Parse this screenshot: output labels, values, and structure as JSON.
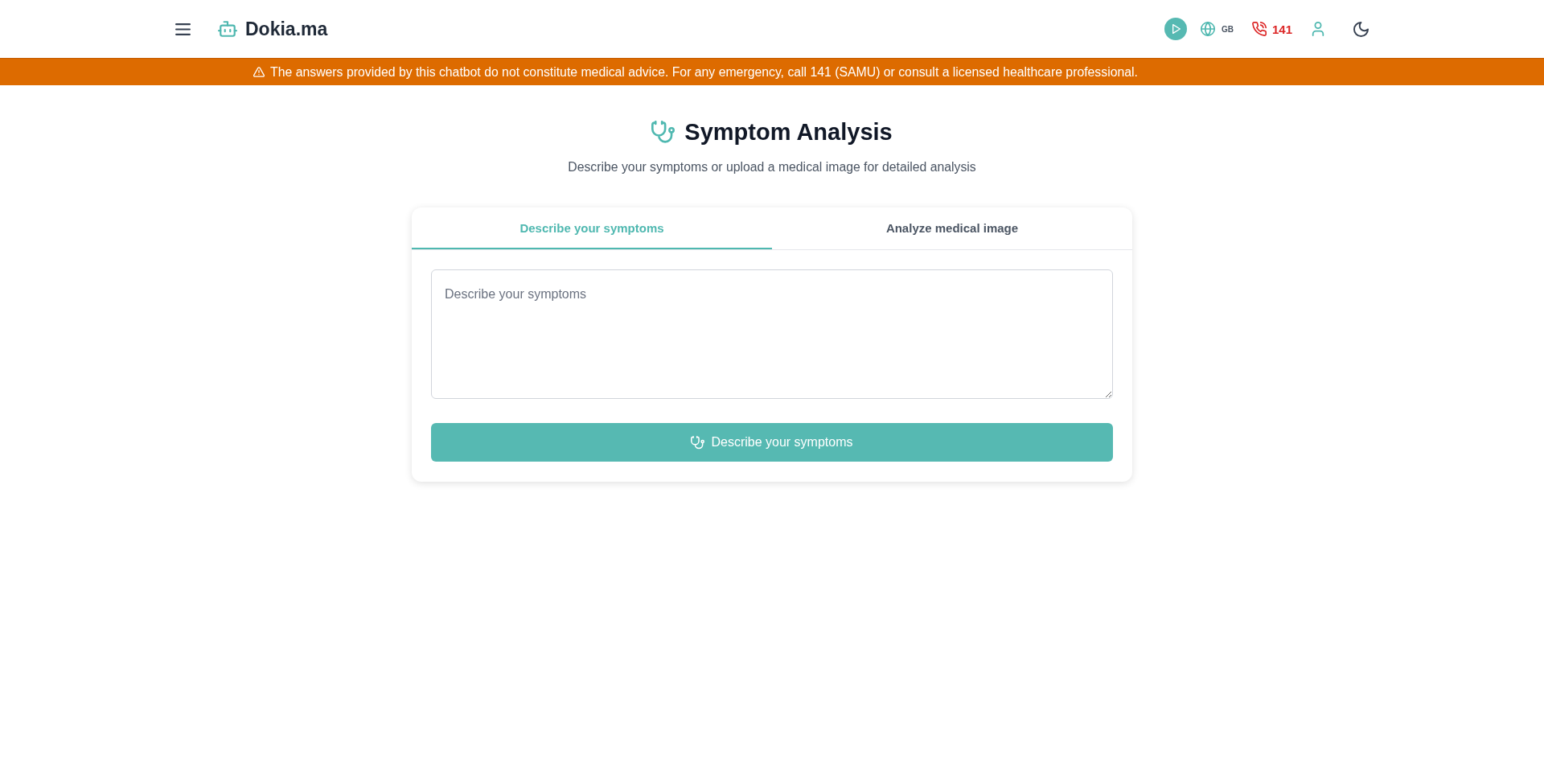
{
  "header": {
    "brand": "Dokia.ma",
    "language": "GB",
    "emergency_number": "141"
  },
  "banner": {
    "text": "The answers provided by this chatbot do not constitute medical advice. For any emergency, call 141 (SAMU) or consult a licensed healthcare professional."
  },
  "page": {
    "title": "Symptom Analysis",
    "subtitle": "Describe your symptoms or upload a medical image for detailed analysis"
  },
  "tabs": [
    {
      "label": "Describe your symptoms",
      "selected": true
    },
    {
      "label": "Analyze medical image",
      "selected": false
    }
  ],
  "symptoms_field": {
    "placeholder": "Describe your symptoms"
  },
  "submit_button": {
    "label": "Describe your symptoms"
  }
}
